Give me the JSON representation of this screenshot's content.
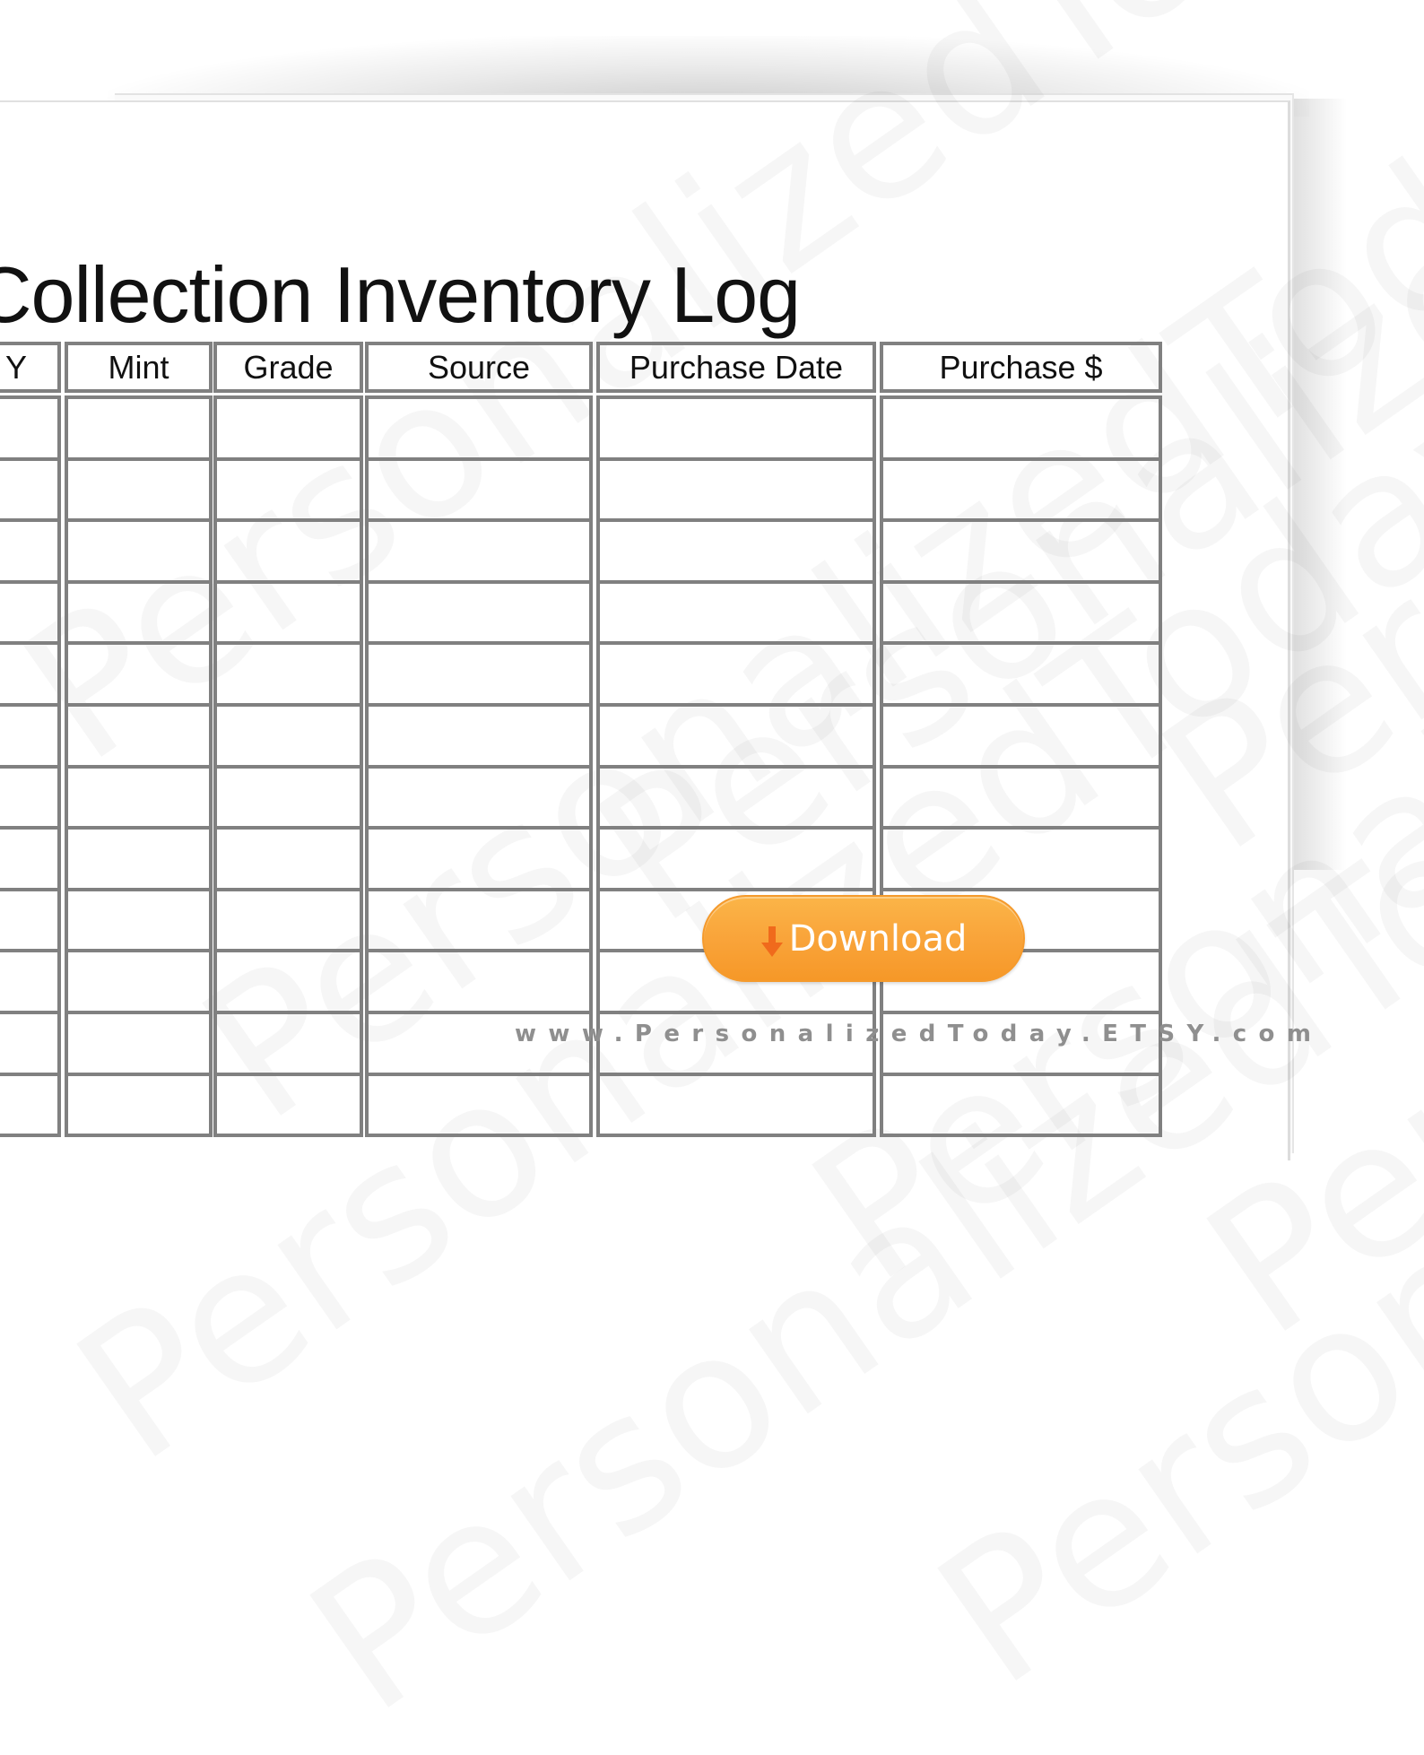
{
  "document": {
    "title": "Collection Inventory Log",
    "columns": [
      {
        "label": "Y"
      },
      {
        "label": "Mint"
      },
      {
        "label": "Grade"
      },
      {
        "label": "Source"
      },
      {
        "label": "Purchase Date"
      },
      {
        "label": "Purchase $"
      }
    ],
    "visible_row_count": 12
  },
  "watermark": {
    "text": "PersonalizedToday"
  },
  "download_button": {
    "label": "Download",
    "icon": "download-arrow-icon",
    "colors": {
      "fill": "#f9a43a",
      "arrow": "#f06a1c",
      "text": "#ffffff"
    }
  },
  "footer": {
    "url": "www.PersonalizedToday.ETSY.com"
  }
}
